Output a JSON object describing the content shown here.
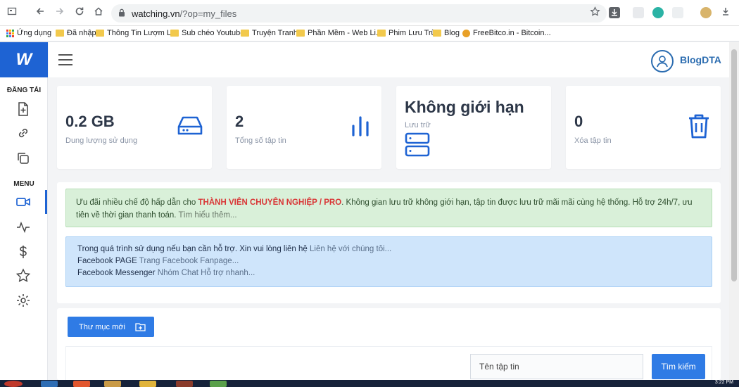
{
  "browser": {
    "url_domain": "watching.vn",
    "url_path": "/?op=my_files",
    "bookmarks": [
      {
        "label": "Ứng dụng",
        "kind": "apps"
      },
      {
        "label": "Đã nhập",
        "kind": "folder"
      },
      {
        "label": "Thông Tin Lượm Lặt",
        "kind": "folder"
      },
      {
        "label": "Sub chéo Youtube",
        "kind": "folder"
      },
      {
        "label": "Truyện Tranh",
        "kind": "folder"
      },
      {
        "label": "Phần Mềm - Web Li...",
        "kind": "folder"
      },
      {
        "label": "Phim Lưu Trữ",
        "kind": "folder"
      },
      {
        "label": "Blog",
        "kind": "folder"
      },
      {
        "label": "FreeBitco.in - Bitcoin...",
        "kind": "coin"
      }
    ]
  },
  "app": {
    "logo": "W",
    "username": "BlogDTA"
  },
  "sidebar": {
    "upload_heading": "ĐĂNG TẢI",
    "menu_heading": "MENU"
  },
  "stats": [
    {
      "value": "0.2 GB",
      "label": "Dung lượng sử dụng",
      "icon": "hard-drive-icon"
    },
    {
      "value": "2",
      "label": "Tổng số tập tin",
      "icon": "bar-chart-icon"
    },
    {
      "value": "Không giới hạn",
      "label": "Lưu trữ",
      "icon": "server-icon"
    },
    {
      "value": "0",
      "label": "Xóa tập tin",
      "icon": "trash-icon"
    }
  ],
  "alerts": {
    "pro": {
      "prefix": "Ưu đãi nhiều chế độ hấp dẫn cho ",
      "highlight": "THÀNH VIÊN CHUYÊN NGHIỆP / PRO",
      "suffix": ". Không gian lưu trữ không giới hạn, tập tin được lưu trữ mãi mãi cùng hệ thống. Hỗ trợ 24h/7, ưu tiên về thời gian thanh toán. ",
      "more": "Tìm hiểu thêm..."
    },
    "support": [
      {
        "text": "Trong quá trình sử dụng nếu bạn cần hỗ trợ. Xin vui lòng liên hệ ",
        "link": "Liên hệ với chúng tôi..."
      },
      {
        "text": "Facebook PAGE ",
        "link": "Trang Facebook Fanpage..."
      },
      {
        "text": "Facebook Messenger ",
        "link": "Nhóm Chat Hỗ trợ nhanh..."
      }
    ]
  },
  "files": {
    "new_folder_label": "Thư mục mới",
    "search_placeholder": "Tên tập tin",
    "search_button": "Tìm kiếm"
  },
  "colors": {
    "brand": "#1e63d3",
    "primary_button": "#2f7be5",
    "pro_highlight": "#d93636"
  },
  "taskbar": {
    "clock": "3:22 PM"
  }
}
